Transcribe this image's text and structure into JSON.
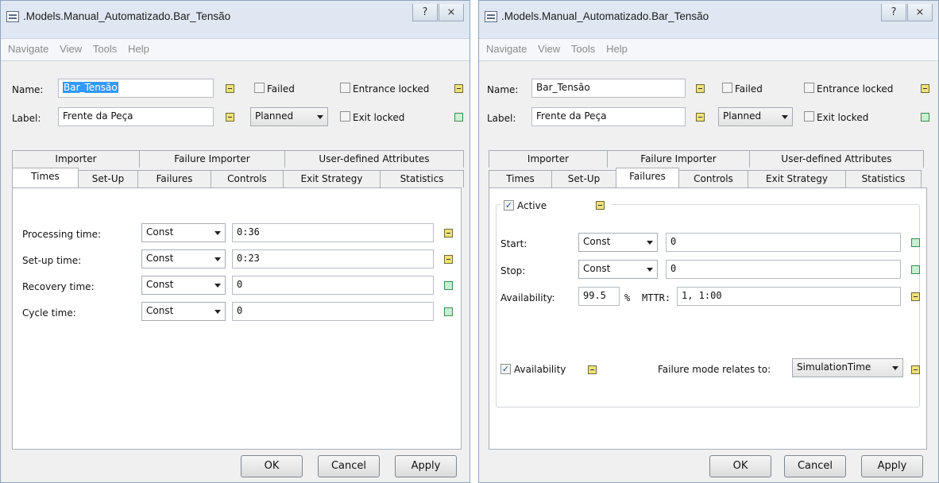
{
  "left": {
    "title": ".Models.Manual_Automatizado.Bar_Tensão",
    "help_glyph": "?",
    "close_glyph": "⨯",
    "menu": [
      "Navigate",
      "View",
      "Tools",
      "Help"
    ],
    "name_label": "Name:",
    "name_value": "Bar_Tensão",
    "label_label": "Label:",
    "label_value": "Frente da Peça",
    "failed_label": "Failed",
    "planned_value": "Planned",
    "entrance_locked_label": "Entrance locked",
    "exit_locked_label": "Exit locked",
    "tabs_top": [
      "Importer",
      "Failure Importer",
      "User-defined Attributes"
    ],
    "tabs_bottom": [
      "Times",
      "Set-Up",
      "Failures",
      "Controls",
      "Exit Strategy",
      "Statistics"
    ],
    "times": [
      {
        "label": "Processing time:",
        "dist": "Const",
        "value": "0:36"
      },
      {
        "label": "Set-up time:",
        "dist": "Const",
        "value": "0:23"
      },
      {
        "label": "Recovery time:",
        "dist": "Const",
        "value": "0"
      },
      {
        "label": "Cycle time:",
        "dist": "Const",
        "value": "0"
      }
    ],
    "buttons": {
      "ok": "OK",
      "cancel": "Cancel",
      "apply": "Apply"
    }
  },
  "right": {
    "title": ".Models.Manual_Automatizado.Bar_Tensão",
    "help_glyph": "?",
    "close_glyph": "⨯",
    "menu": [
      "Navigate",
      "View",
      "Tools",
      "Help"
    ],
    "name_label": "Name:",
    "name_value": "Bar_Tensão",
    "label_label": "Label:",
    "label_value": "Frente da Peça",
    "failed_label": "Failed",
    "planned_value": "Planned",
    "entrance_locked_label": "Entrance locked",
    "exit_locked_label": "Exit locked",
    "tabs_top": [
      "Importer",
      "Failure Importer",
      "User-defined Attributes"
    ],
    "tabs_bottom": [
      "Times",
      "Set-Up",
      "Failures",
      "Controls",
      "Exit Strategy",
      "Statistics"
    ],
    "failures": {
      "active_label": "Active",
      "start_label": "Start:",
      "start_dist": "Const",
      "start_value": "0",
      "stop_label": "Stop:",
      "stop_dist": "Const",
      "stop_value": "0",
      "availability_label": "Availability:",
      "availability_value": "99.5",
      "percent": "%",
      "mttr_label": "MTTR:",
      "mttr_value": "1, 1:00",
      "availability_check_label": "Availability",
      "relates_label": "Failure mode relates to:",
      "relates_value": "SimulationTime"
    },
    "buttons": {
      "ok": "OK",
      "cancel": "Cancel",
      "apply": "Apply"
    }
  },
  "check_glyph": "✓"
}
